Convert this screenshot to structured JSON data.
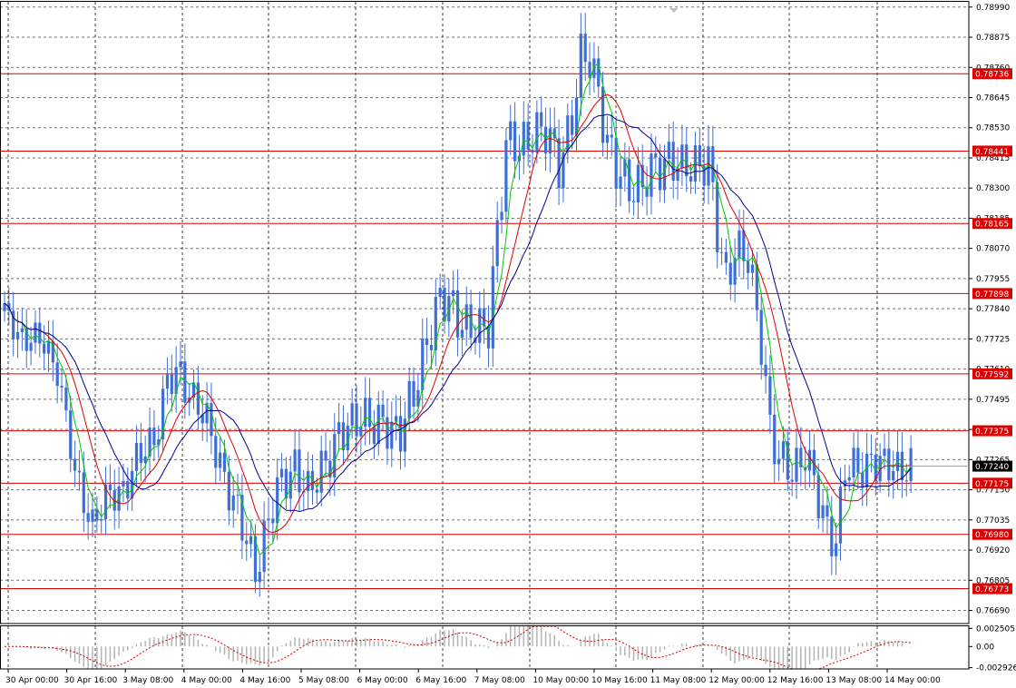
{
  "chart_data": {
    "type": "candlestick",
    "main": {
      "ylim": [
        0.7664,
        0.7901
      ],
      "price_ticks": [
        "0.78990",
        "0.78875",
        "0.78760",
        "0.78645",
        "0.78530",
        "0.78415",
        "0.78300",
        "0.78185",
        "0.78070",
        "0.77955",
        "0.77840",
        "0.77725",
        "0.77610",
        "0.77495",
        "0.77380",
        "0.77265",
        "0.77150",
        "0.77035",
        "0.76920",
        "0.76805",
        "0.76690"
      ],
      "levels": [
        {
          "value": 0.78736,
          "label": "0.78736"
        },
        {
          "value": 0.78441,
          "label": "0.78441"
        },
        {
          "value": 0.78165,
          "label": "0.78165"
        },
        {
          "value": 0.77898,
          "label": "0.77898"
        },
        {
          "value": 0.77592,
          "label": "0.77592"
        },
        {
          "value": 0.77375,
          "label": "0.77375"
        },
        {
          "value": 0.77175,
          "label": "0.77175"
        },
        {
          "value": 0.7698,
          "label": "0.76980"
        },
        {
          "value": 0.76773,
          "label": "0.76773"
        }
      ],
      "current_price": {
        "value": 0.7724,
        "label": "0.77240"
      },
      "anchors": [
        [
          0,
          0.7781
        ],
        [
          4,
          0.7774
        ],
        [
          9,
          0.777
        ],
        [
          12,
          0.7762
        ],
        [
          16,
          0.772
        ],
        [
          20,
          0.7703
        ],
        [
          24,
          0.7712
        ],
        [
          27,
          0.7716
        ],
        [
          30,
          0.7725
        ],
        [
          34,
          0.7735
        ],
        [
          37,
          0.7756
        ],
        [
          40,
          0.7758
        ],
        [
          44,
          0.7748
        ],
        [
          48,
          0.773
        ],
        [
          51,
          0.7716
        ],
        [
          54,
          0.77
        ],
        [
          57,
          0.7685
        ],
        [
          60,
          0.7703
        ],
        [
          63,
          0.7718
        ],
        [
          66,
          0.7725
        ],
        [
          69,
          0.7712
        ],
        [
          72,
          0.7724
        ],
        [
          75,
          0.7732
        ],
        [
          78,
          0.7738
        ],
        [
          81,
          0.7745
        ],
        [
          84,
          0.7738
        ],
        [
          87,
          0.774
        ],
        [
          90,
          0.7738
        ],
        [
          93,
          0.775
        ],
        [
          96,
          0.7773
        ],
        [
          99,
          0.7787
        ],
        [
          102,
          0.7784
        ],
        [
          105,
          0.7778
        ],
        [
          108,
          0.7774
        ],
        [
          110,
          0.7778
        ],
        [
          112,
          0.7815
        ],
        [
          114,
          0.7846
        ],
        [
          117,
          0.7845
        ],
        [
          120,
          0.7852
        ],
        [
          123,
          0.785
        ],
        [
          126,
          0.784
        ],
        [
          129,
          0.7856
        ],
        [
          131,
          0.7878
        ],
        [
          133,
          0.788
        ],
        [
          135,
          0.7868
        ],
        [
          137,
          0.7846
        ],
        [
          139,
          0.7836
        ],
        [
          142,
          0.7832
        ],
        [
          145,
          0.783
        ],
        [
          148,
          0.7838
        ],
        [
          151,
          0.7842
        ],
        [
          154,
          0.7836
        ],
        [
          157,
          0.784
        ],
        [
          160,
          0.784
        ],
        [
          162,
          0.7812
        ],
        [
          164,
          0.7795
        ],
        [
          166,
          0.7808
        ],
        [
          169,
          0.7802
        ],
        [
          172,
          0.7772
        ],
        [
          174,
          0.774
        ],
        [
          176,
          0.7725
        ],
        [
          179,
          0.7722
        ],
        [
          182,
          0.773
        ],
        [
          185,
          0.771
        ],
        [
          187,
          0.77
        ],
        [
          189,
          0.7697
        ],
        [
          191,
          0.7722
        ],
        [
          194,
          0.7722
        ],
        [
          197,
          0.7727
        ],
        [
          200,
          0.7723
        ],
        [
          203,
          0.7724
        ],
        [
          206,
          0.7724
        ]
      ],
      "bars": 207
    },
    "ma_lines": [
      {
        "color": "#00c800",
        "period": 5
      },
      {
        "color": "#e00000",
        "period": 10
      },
      {
        "color": "#000090",
        "period": 17
      }
    ],
    "oscillator": {
      "ticks": [
        "0.002505",
        "0.00",
        "-0.002926"
      ],
      "ylim": [
        -0.0031,
        0.0028
      ]
    },
    "x_labels": [
      "30 Apr 00:00",
      "30 Apr 16:00",
      "3 May 08:00",
      "4 May 00:00",
      "4 May 16:00",
      "5 May 08:00",
      "6 May 00:00",
      "6 May 16:00",
      "7 May 08:00",
      "10 May 00:00",
      "10 May 16:00",
      "11 May 08:00",
      "12 May 00:00",
      "12 May 16:00",
      "13 May 08:00",
      "14 May 00:00"
    ],
    "colors": {
      "candle": "#3d6fd6",
      "level": "#dd0000",
      "grid": "#000000",
      "histogram": "#b4b4b4",
      "signal": "#cc0000",
      "current": "#000000"
    }
  }
}
